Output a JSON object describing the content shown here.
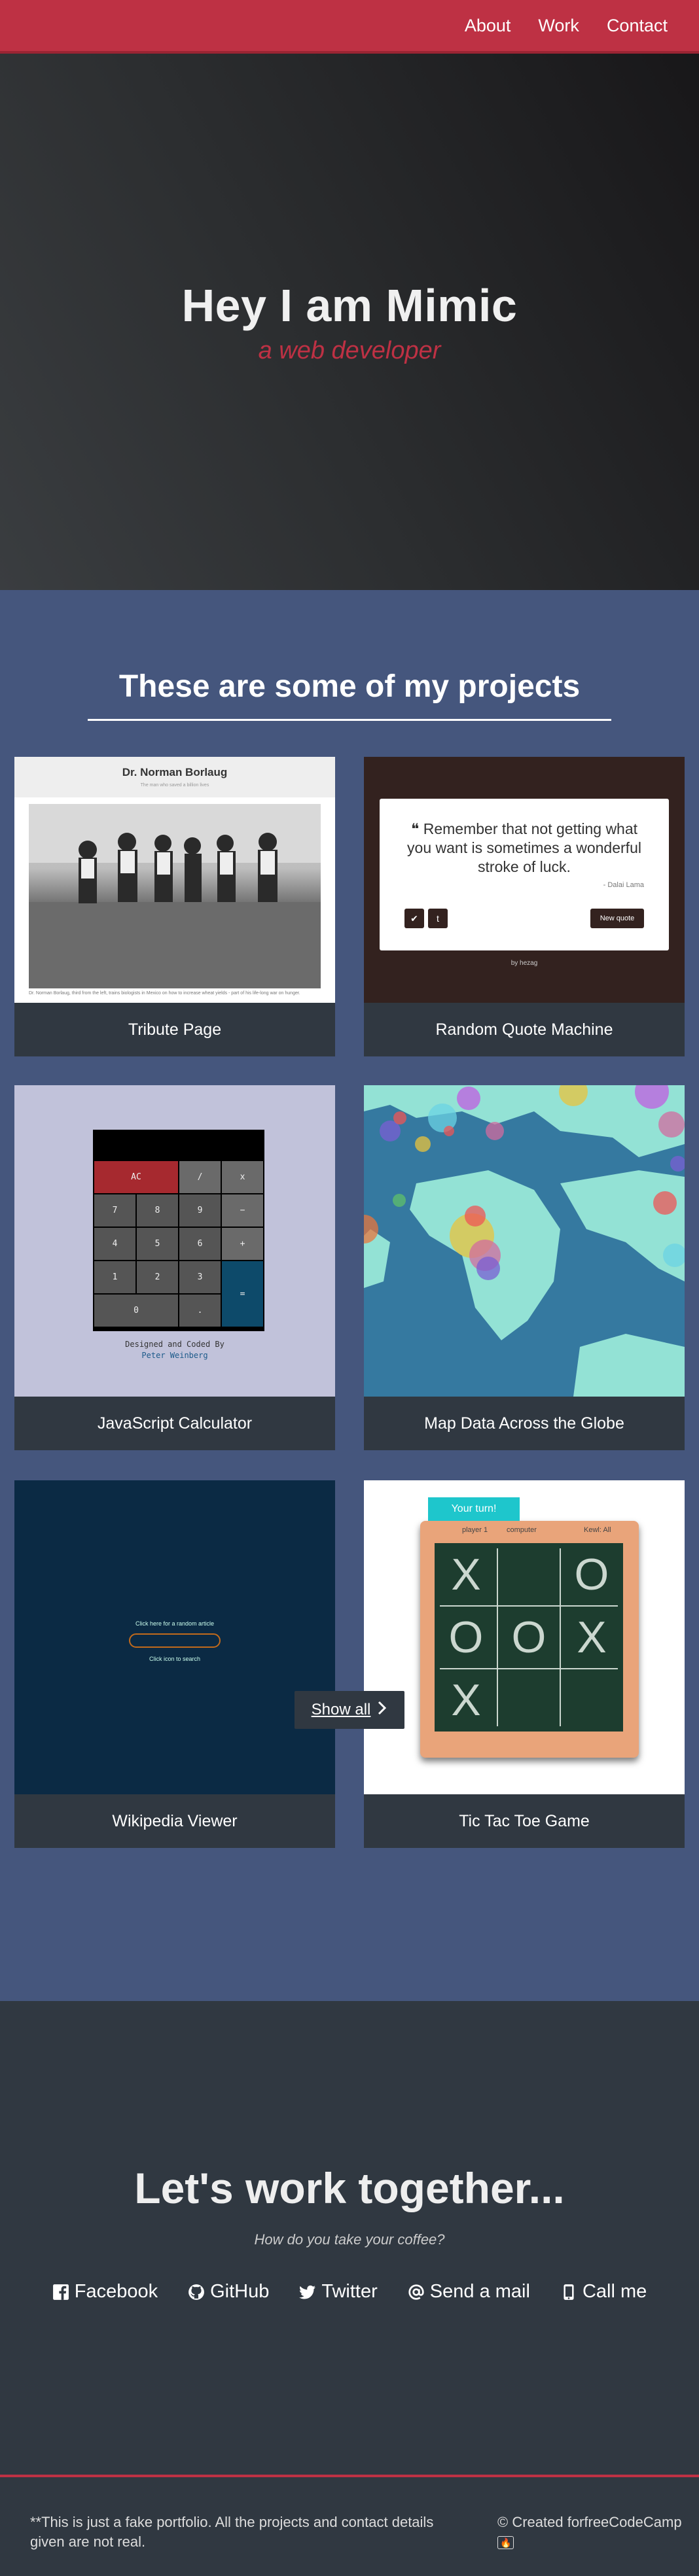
{
  "nav": {
    "about": "About",
    "work": "Work",
    "contact": "Contact"
  },
  "hero": {
    "title": "Hey I am Mimic",
    "subtitle": "a web developer"
  },
  "projects": {
    "heading": "These are some of my projects",
    "items": [
      {
        "label": "Tribute Page",
        "thumb_title": "Dr. Norman Borlaug",
        "thumb_subtitle": "The man who saved a billion lives",
        "thumb_caption": "Dr. Norman Borlaug, third from the left, trains biologists in Mexico on how to increase wheat yields - part of his life-long war on hunger."
      },
      {
        "label": "Random Quote Machine",
        "quote": "Remember that not getting what you want is sometimes a wonderful stroke of luck.",
        "author": "- Dalai Lama",
        "new_quote": "New quote",
        "byline": "by hezag"
      },
      {
        "label": "JavaScript Calculator",
        "keys": [
          "AC",
          "/",
          "x",
          "7",
          "8",
          "9",
          "−",
          "4",
          "5",
          "6",
          "+",
          "1",
          "2",
          "3",
          "=",
          "0",
          "."
        ],
        "credit_line1": "Designed and Coded By",
        "credit_line2": "Peter Weinberg"
      },
      {
        "label": "Map Data Across the Globe"
      },
      {
        "label": "Wikipedia Viewer",
        "line1": "Click here for a random article",
        "line2": "Click icon to search"
      },
      {
        "label": "Tic Tac Toe Game",
        "turn": "Your turn!",
        "player1": "player 1",
        "computer": "computer",
        "kewl": "Kewl: All",
        "board": [
          "X",
          "",
          "O",
          "O",
          "O",
          "X",
          "X",
          "",
          ""
        ]
      }
    ],
    "show_all": "Show all"
  },
  "contact": {
    "heading": "Let's work together...",
    "subheading": "How do you take your coffee?",
    "links": [
      {
        "label": "Facebook",
        "icon": "facebook-icon"
      },
      {
        "label": "GitHub",
        "icon": "github-icon"
      },
      {
        "label": "Twitter",
        "icon": "twitter-icon"
      },
      {
        "label": "Send a mail",
        "icon": "at-icon"
      },
      {
        "label": "Call me",
        "icon": "mobile-icon"
      }
    ]
  },
  "footer": {
    "note": "**This is just a fake portfolio. All the projects and contact details given are not real.",
    "credit": "© Created forfreeCodeCamp"
  },
  "colors": {
    "accent": "#be3144",
    "projects_bg": "#45567d",
    "dark": "#303841"
  }
}
